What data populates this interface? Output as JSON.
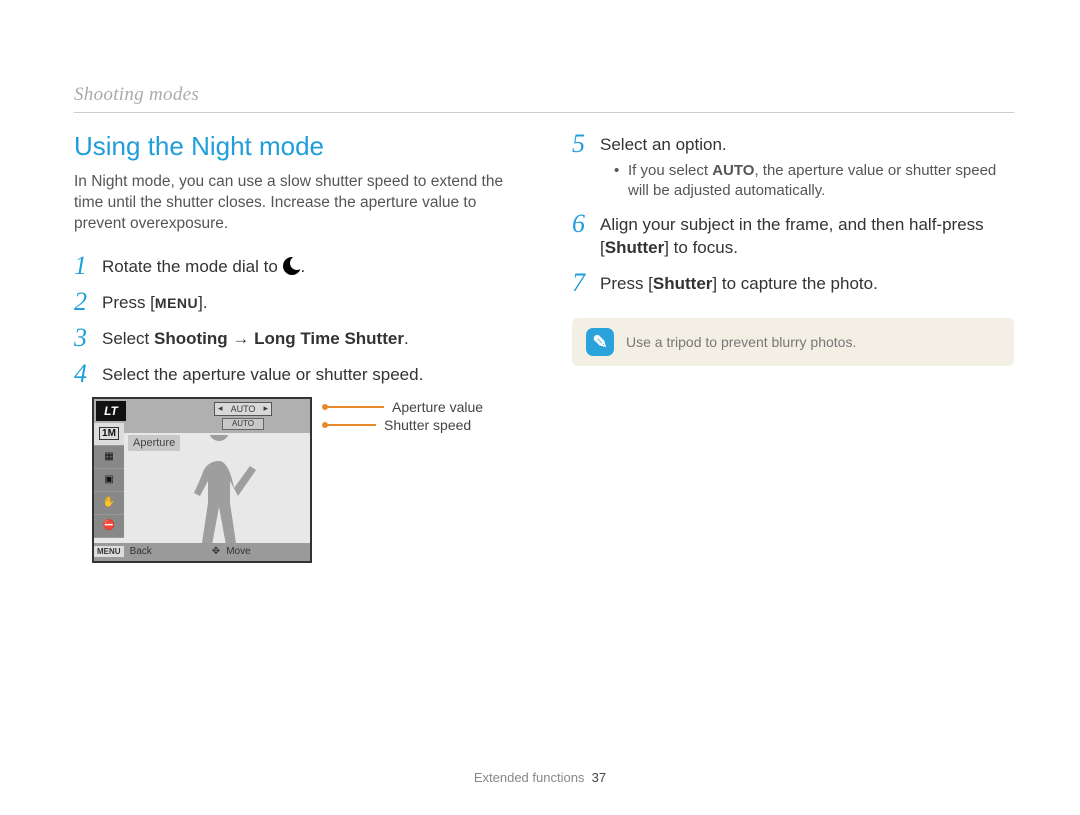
{
  "breadcrumb": "Shooting modes",
  "section_title": "Using the Night mode",
  "intro": "In Night mode, you can use a slow shutter speed to extend the time until the shutter closes. Increase the aperture value to prevent overexposure.",
  "steps": {
    "s1_prefix": "Rotate the mode dial to ",
    "s1_suffix": ".",
    "s2_prefix": "Press [",
    "s2_menu": "MENU",
    "s2_suffix": "].",
    "s3_prefix": "Select ",
    "s3_bold_a": "Shooting",
    "s3_arrow": " → ",
    "s3_bold_b": "Long Time Shutter",
    "s3_suffix": ".",
    "s4": "Select the aperture value or shutter speed.",
    "s5": "Select an option.",
    "s5_sub_prefix": "If you select ",
    "s5_sub_bold": "AUTO",
    "s5_sub_suffix": ", the aperture value or shutter speed will be adjusted automatically.",
    "s6_a": "Align your subject in the frame, and then half-press [",
    "s6_bold": "Shutter",
    "s6_b": "] to focus.",
    "s7_a": "Press [",
    "s7_bold": "Shutter",
    "s7_b": "] to capture the photo."
  },
  "camera": {
    "lt": "LT",
    "auto": "AUTO",
    "aperture": "Aperture",
    "back": "Back",
    "move": "Move",
    "menu": "MENU",
    "side_1m": "1M"
  },
  "callouts": {
    "aperture": "Aperture value",
    "shutter": "Shutter speed"
  },
  "note": {
    "icon": "✎",
    "text": "Use a tripod to prevent blurry photos."
  },
  "footer": {
    "section": "Extended functions",
    "page": "37"
  }
}
